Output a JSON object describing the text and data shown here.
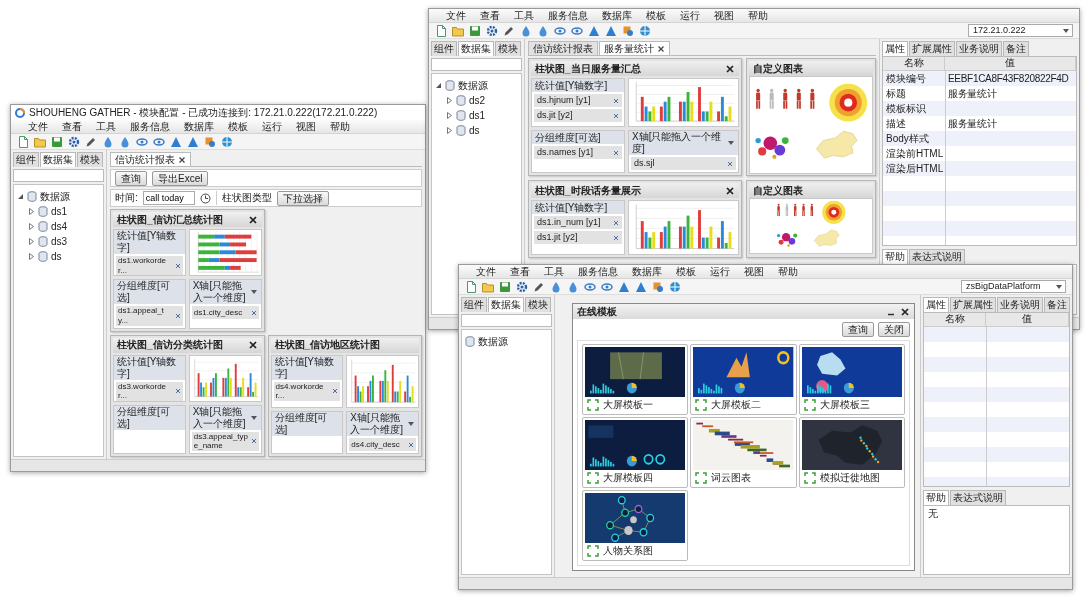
{
  "report_window": {
    "title": "SHOUHENG GATHER - 模块配置 - 已成功连接到: 172.21.0.222(172.21.0.222)",
    "menu": [
      "文件",
      "查看",
      "工具",
      "服务信息",
      "数据库",
      "模板",
      "运行",
      "视图",
      "帮助"
    ],
    "side_tabs": [
      {
        "label": "组件",
        "selected": false
      },
      {
        "label": "数据集",
        "selected": true
      },
      {
        "label": "模块",
        "selected": false
      }
    ],
    "tree": {
      "label": "数据源",
      "expanded": true,
      "children": [
        {
          "label": "ds1",
          "expanded": false
        },
        {
          "label": "ds4",
          "expanded": false
        },
        {
          "label": "ds3",
          "expanded": false
        },
        {
          "label": "ds",
          "expanded": false
        }
      ]
    },
    "doc_tabs": [
      {
        "label": "信访统计报表",
        "selected": true
      }
    ],
    "buttons": [
      "查询",
      "导出Excel"
    ],
    "filters": [
      {
        "kind": "date",
        "label": "时间:",
        "value": "call today"
      },
      {
        "kind": "select",
        "label": "柱状图类型",
        "value": "下拉选择"
      }
    ],
    "panels": [
      {
        "kind": "stacked",
        "title": "柱状图_信访汇总统计图",
        "closable": true,
        "measure_label": "统计值[Y轴数字]",
        "measures": [
          "ds1.workorder..."
        ],
        "group_label": "分组维度[可选]",
        "groups": [
          "ds1.appeal_ty..."
        ],
        "x_label": "X轴[只能拖入一个维度]",
        "x_fields": [
          "ds1.city_desc"
        ]
      },
      {
        "kind": "bar",
        "title": "柱状图_信访分类统计图",
        "closable": true,
        "measure_label": "统计值[Y轴数字]",
        "measures": [
          "ds3.workorder..."
        ],
        "group_label": "分组维度[可选]",
        "x_label": "X轴[只能拖入一个维度]",
        "x_fields": [
          "ds3.appeal_type_name"
        ]
      },
      {
        "kind": "bar",
        "title": "柱状图_信访地区统计图",
        "closable": false,
        "measure_label": "统计值[Y轴数字]",
        "measures": [
          "ds4.workorder..."
        ],
        "group_label": "分组维度[可选]",
        "x_label": "X轴[只能拖入一个维度]",
        "x_fields": [
          "ds4.city_desc"
        ]
      }
    ]
  },
  "design_window": {
    "menu": [
      "文件",
      "查看",
      "工具",
      "服务信息",
      "数据库",
      "模板",
      "运行",
      "视图",
      "帮助"
    ],
    "server": "172.21.0.222",
    "side_tabs": [
      {
        "label": "组件",
        "selected": false
      },
      {
        "label": "数据集",
        "selected": true
      },
      {
        "label": "模块",
        "selected": false
      }
    ],
    "tree": {
      "label": "数据源",
      "expanded": true,
      "children": [
        {
          "label": "ds2",
          "expanded": false
        },
        {
          "label": "ds1",
          "expanded": false
        },
        {
          "label": "ds",
          "expanded": false
        }
      ]
    },
    "doc_tabs": [
      {
        "label": "信访统计报表",
        "selected": false
      },
      {
        "label": "服务量统计",
        "selected": true
      }
    ],
    "panels": [
      {
        "kind": "bar",
        "title": "柱状图_当日服务量汇总",
        "closable": true,
        "measure_label": "统计值[Y轴数字]",
        "measures": [
          "ds.hjnum [y1]",
          "ds.jit [y2]"
        ],
        "group_label": "分组维度[可选]",
        "groups": [
          "ds.names [y1]"
        ],
        "x_label": "X轴[只能拖入一个维度]",
        "x_fields": [
          "ds.sjl"
        ]
      },
      {
        "kind": "custom",
        "title": "自定义图表"
      },
      {
        "kind": "bar",
        "title": "柱状图_时段话务量展示",
        "closable": true,
        "measure_label": "统计值[Y轴数字]",
        "measures": [
          "ds1.in_num [y1]",
          "ds1.jit [y2]"
        ]
      },
      {
        "kind": "custom",
        "title": "自定义图表"
      }
    ],
    "properties": {
      "tabs": [
        {
          "label": "属性",
          "selected": true
        },
        {
          "label": "扩展属性",
          "selected": false
        },
        {
          "label": "业务说明",
          "selected": false
        },
        {
          "label": "备注",
          "selected": false
        }
      ],
      "columns": [
        "名称",
        "值"
      ],
      "rows": [
        {
          "name": "模块编号",
          "value": "EEBF1CA8F43F820822F4D"
        },
        {
          "name": "标题",
          "value": "服务量统计"
        },
        {
          "name": "模板标识"
        },
        {
          "name": "描述",
          "value": "服务量统计"
        },
        {
          "name": "Body样式"
        },
        {
          "name": "渲染前HTML"
        },
        {
          "name": "渲染后HTML"
        }
      ],
      "bottom_tabs": [
        {
          "label": "帮助",
          "selected": true
        },
        {
          "label": "表达式说明",
          "selected": false
        }
      ]
    }
  },
  "template_window": {
    "menu": [
      "文件",
      "查看",
      "工具",
      "服务信息",
      "数据库",
      "模板",
      "运行",
      "视图",
      "帮助"
    ],
    "server": "zsBigDataPlatform",
    "side_tabs": [
      {
        "label": "组件",
        "selected": false
      },
      {
        "label": "数据集",
        "selected": true
      },
      {
        "label": "模块",
        "selected": false
      }
    ],
    "tree": {
      "label": "数据源"
    },
    "dialog": {
      "title": "在线模板",
      "buttons": [
        "查询",
        "关闭"
      ],
      "templates": [
        {
          "name": "大屏模板一",
          "kind": "dashboard"
        },
        {
          "name": "大屏模板二",
          "kind": "dashboard"
        },
        {
          "name": "大屏模板三",
          "kind": "dashboard"
        },
        {
          "name": "大屏模板四",
          "kind": "dashboard"
        },
        {
          "name": "词云图表",
          "kind": "wordcloud"
        },
        {
          "name": "模拟迁徙地图",
          "kind": "map"
        },
        {
          "name": "人物关系图",
          "kind": "network"
        }
      ]
    },
    "properties": {
      "tabs": [
        {
          "label": "属性",
          "selected": true
        },
        {
          "label": "扩展属性",
          "selected": false
        },
        {
          "label": "业务说明",
          "selected": false
        },
        {
          "label": "备注",
          "selected": false
        }
      ],
      "columns": [
        "名称",
        "值"
      ],
      "bottom_tabs": [
        {
          "label": "帮助",
          "selected": true
        },
        {
          "label": "表达式说明",
          "selected": false
        }
      ],
      "help_text": "无"
    }
  }
}
